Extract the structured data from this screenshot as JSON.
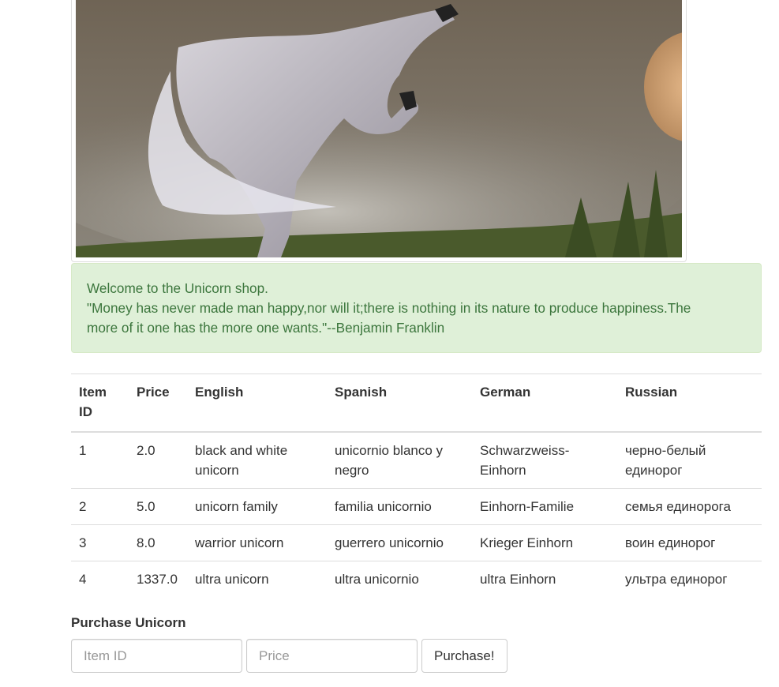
{
  "hero": {
    "image": "unicorn-rearing-photo"
  },
  "alert": {
    "welcome": "Welcome to the Unicorn shop.",
    "quote": "\"Money has never made man happy,nor will it;there is nothing in its nature to produce happiness.The more of it one has the more one wants.\"--Benjamin Franklin"
  },
  "table": {
    "headers": [
      "Item ID",
      "Price",
      "English",
      "Spanish",
      "German",
      "Russian"
    ],
    "rows": [
      {
        "id": "1",
        "price": "2.0",
        "english": "black and white unicorn",
        "spanish": "unicornio blanco y negro",
        "german": "Schwarzweiss-Einhorn",
        "russian": "черно-белый единорог"
      },
      {
        "id": "2",
        "price": "5.0",
        "english": "unicorn family",
        "spanish": "familia unicornio",
        "german": "Einhorn-Familie",
        "russian": "семья единорога"
      },
      {
        "id": "3",
        "price": "8.0",
        "english": "warrior unicorn",
        "spanish": "guerrero unicornio",
        "german": "Krieger Einhorn",
        "russian": "воин единорог"
      },
      {
        "id": "4",
        "price": "1337.0",
        "english": "ultra unicorn",
        "spanish": "ultra unicornio",
        "german": "ultra Einhorn",
        "russian": "ультра единорог"
      }
    ]
  },
  "purchase": {
    "title": "Purchase Unicorn",
    "item_id_placeholder": "Item ID",
    "item_id_value": "",
    "price_placeholder": "Price",
    "price_value": "",
    "button_label": "Purchase!"
  },
  "colors": {
    "alert_bg": "#dff0d8",
    "alert_text": "#3c763d",
    "border": "#dddddd"
  }
}
